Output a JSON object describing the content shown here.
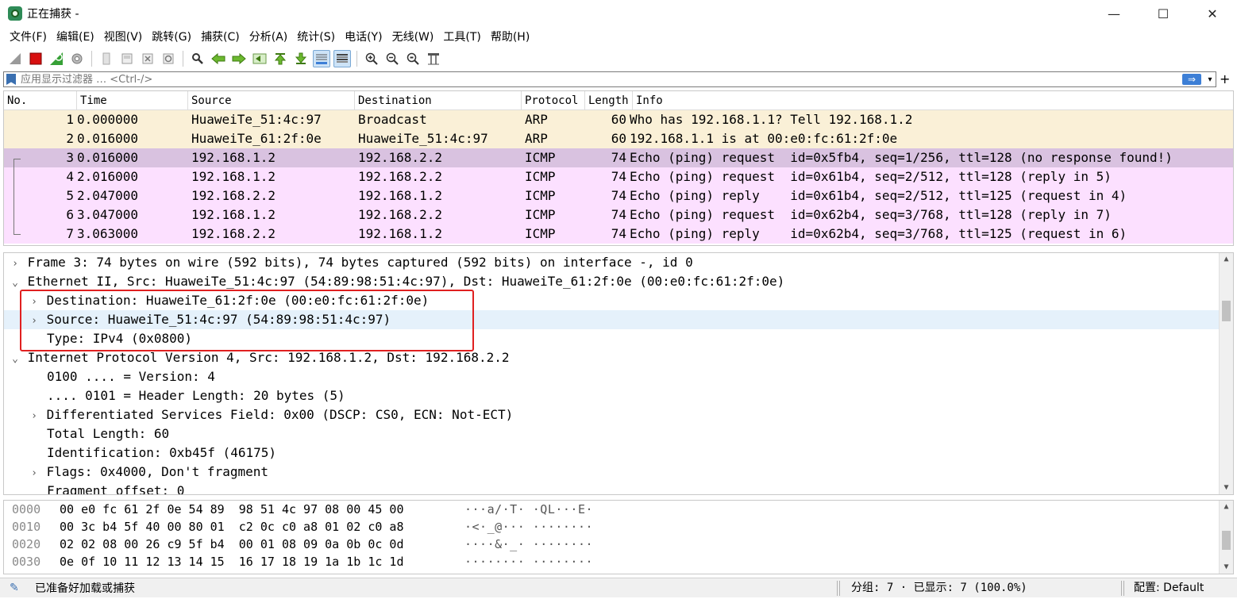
{
  "window": {
    "title": "正在捕获 -",
    "minimize": "—",
    "maximize": "☐",
    "close": "✕"
  },
  "menu": [
    "文件(F)",
    "编辑(E)",
    "视图(V)",
    "跳转(G)",
    "捕获(C)",
    "分析(A)",
    "统计(S)",
    "电话(Y)",
    "无线(W)",
    "工具(T)",
    "帮助(H)"
  ],
  "filter": {
    "placeholder": "应用显示过滤器 … <Ctrl-/>",
    "apply_icon": "⇒",
    "dropdown": "▾",
    "add": "+"
  },
  "packet_list": {
    "columns": [
      "No.",
      "Time",
      "Source",
      "Destination",
      "Protocol",
      "Length",
      "Info"
    ],
    "rows": [
      {
        "no": "1",
        "time": "0.000000",
        "src": "HuaweiTe_51:4c:97",
        "dst": "Broadcast",
        "proto": "ARP",
        "len": "60",
        "info": "Who has 192.168.1.1? Tell 192.168.1.2",
        "kind": "arp"
      },
      {
        "no": "2",
        "time": "0.016000",
        "src": "HuaweiTe_61:2f:0e",
        "dst": "HuaweiTe_51:4c:97",
        "proto": "ARP",
        "len": "60",
        "info": "192.168.1.1 is at 00:e0:fc:61:2f:0e",
        "kind": "arp"
      },
      {
        "no": "3",
        "time": "0.016000",
        "src": "192.168.1.2",
        "dst": "192.168.2.2",
        "proto": "ICMP",
        "len": "74",
        "info": "Echo (ping) request  id=0x5fb4, seq=1/256, ttl=128 (no response found!)",
        "kind": "sel"
      },
      {
        "no": "4",
        "time": "2.016000",
        "src": "192.168.1.2",
        "dst": "192.168.2.2",
        "proto": "ICMP",
        "len": "74",
        "info": "Echo (ping) request  id=0x61b4, seq=2/512, ttl=128 (reply in 5)",
        "kind": "icmp"
      },
      {
        "no": "5",
        "time": "2.047000",
        "src": "192.168.2.2",
        "dst": "192.168.1.2",
        "proto": "ICMP",
        "len": "74",
        "info": "Echo (ping) reply    id=0x61b4, seq=2/512, ttl=125 (request in 4)",
        "kind": "icmp"
      },
      {
        "no": "6",
        "time": "3.047000",
        "src": "192.168.1.2",
        "dst": "192.168.2.2",
        "proto": "ICMP",
        "len": "74",
        "info": "Echo (ping) request  id=0x62b4, seq=3/768, ttl=128 (reply in 7)",
        "kind": "icmp"
      },
      {
        "no": "7",
        "time": "3.063000",
        "src": "192.168.2.2",
        "dst": "192.168.1.2",
        "proto": "ICMP",
        "len": "74",
        "info": "Echo (ping) reply    id=0x62b4, seq=3/768, ttl=125 (request in 6)",
        "kind": "icmp"
      }
    ]
  },
  "details": [
    {
      "text": "Frame 3: 74 bytes on wire (592 bits), 74 bytes captured (592 bits) on interface -, id 0",
      "level": 0,
      "arrow": "›",
      "style": ""
    },
    {
      "text": "Ethernet II, Src: HuaweiTe_51:4c:97 (54:89:98:51:4c:97), Dst: HuaweiTe_61:2f:0e (00:e0:fc:61:2f:0e)",
      "level": 0,
      "arrow": "⌄",
      "style": "shaded"
    },
    {
      "text": "Destination: HuaweiTe_61:2f:0e (00:e0:fc:61:2f:0e)",
      "level": 1,
      "arrow": "›",
      "style": ""
    },
    {
      "text": "Source: HuaweiTe_51:4c:97 (54:89:98:51:4c:97)",
      "level": 1,
      "arrow": "›",
      "style": "hover"
    },
    {
      "text": "Type: IPv4 (0x0800)",
      "level": 1,
      "arrow": "",
      "style": ""
    },
    {
      "text": "Internet Protocol Version 4, Src: 192.168.1.2, Dst: 192.168.2.2",
      "level": 0,
      "arrow": "⌄",
      "style": "shaded"
    },
    {
      "text": "0100 .... = Version: 4",
      "level": 1,
      "arrow": "",
      "style": ""
    },
    {
      "text": ".... 0101 = Header Length: 20 bytes (5)",
      "level": 1,
      "arrow": "",
      "style": ""
    },
    {
      "text": "Differentiated Services Field: 0x00 (DSCP: CS0, ECN: Not-ECT)",
      "level": 1,
      "arrow": "›",
      "style": ""
    },
    {
      "text": "Total Length: 60",
      "level": 1,
      "arrow": "",
      "style": ""
    },
    {
      "text": "Identification: 0xb45f (46175)",
      "level": 1,
      "arrow": "",
      "style": ""
    },
    {
      "text": "Flags: 0x4000, Don't fragment",
      "level": 1,
      "arrow": "›",
      "style": ""
    },
    {
      "text": "Fragment offset: 0",
      "level": 1,
      "arrow": "",
      "style": ""
    }
  ],
  "bytes": [
    {
      "offset": "0000",
      "hex": "00 e0 fc 61 2f 0e 54 89  98 51 4c 97 08 00 45 00",
      "ascii": "···a/·T· ·QL···E·"
    },
    {
      "offset": "0010",
      "hex": "00 3c b4 5f 40 00 80 01  c2 0c c0 a8 01 02 c0 a8",
      "ascii": "·<·_@··· ········"
    },
    {
      "offset": "0020",
      "hex": "02 02 08 00 26 c9 5f b4  00 01 08 09 0a 0b 0c 0d",
      "ascii": "····&·_· ········"
    },
    {
      "offset": "0030",
      "hex": "0e 0f 10 11 12 13 14 15  16 17 18 19 1a 1b 1c 1d",
      "ascii": "········ ········"
    }
  ],
  "status": {
    "message": "已准备好加载或捕获",
    "packets": "分组: 7 · 已显示: 7 (100.0%)",
    "profile": "配置: Default"
  },
  "colors": {
    "arp_row": "#faf0d7",
    "icmp_row": "#fce0ff",
    "selected_row": "#d9c2e0",
    "highlight_box": "#e02020"
  }
}
